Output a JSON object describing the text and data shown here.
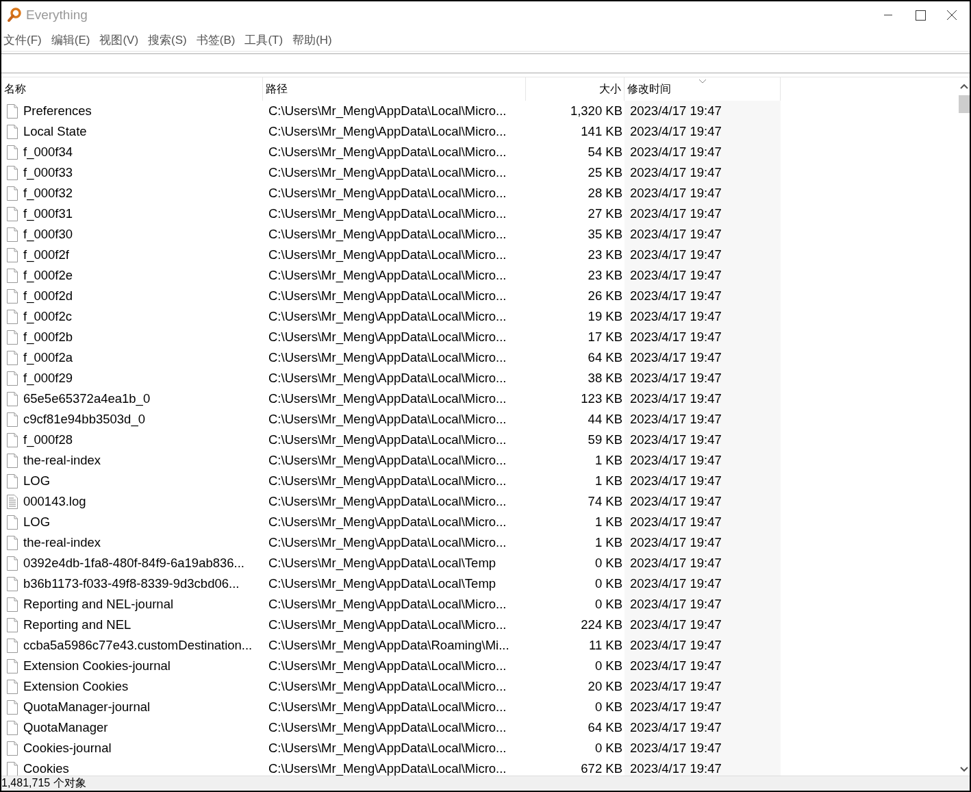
{
  "window": {
    "title": "Everything"
  },
  "menu": [
    "文件(F)",
    "编辑(E)",
    "视图(V)",
    "搜索(S)",
    "书签(B)",
    "工具(T)",
    "帮助(H)"
  ],
  "table": {
    "columns": [
      {
        "label": "名称",
        "sorted": false
      },
      {
        "label": "路径",
        "sorted": false
      },
      {
        "label": "大小",
        "sorted": false
      },
      {
        "label": "修改时间",
        "sorted": true
      }
    ],
    "rows": [
      {
        "kind": "file",
        "name": "Preferences",
        "path": "C:\\Users\\Mr_Meng\\AppData\\Local\\Micro...",
        "size": "1,320 KB",
        "modified": "2023/4/17 19:47"
      },
      {
        "kind": "file",
        "name": "Local State",
        "path": "C:\\Users\\Mr_Meng\\AppData\\Local\\Micro...",
        "size": "141 KB",
        "modified": "2023/4/17 19:47"
      },
      {
        "kind": "file",
        "name": "f_000f34",
        "path": "C:\\Users\\Mr_Meng\\AppData\\Local\\Micro...",
        "size": "54 KB",
        "modified": "2023/4/17 19:47"
      },
      {
        "kind": "file",
        "name": "f_000f33",
        "path": "C:\\Users\\Mr_Meng\\AppData\\Local\\Micro...",
        "size": "25 KB",
        "modified": "2023/4/17 19:47"
      },
      {
        "kind": "file",
        "name": "f_000f32",
        "path": "C:\\Users\\Mr_Meng\\AppData\\Local\\Micro...",
        "size": "28 KB",
        "modified": "2023/4/17 19:47"
      },
      {
        "kind": "file",
        "name": "f_000f31",
        "path": "C:\\Users\\Mr_Meng\\AppData\\Local\\Micro...",
        "size": "27 KB",
        "modified": "2023/4/17 19:47"
      },
      {
        "kind": "file",
        "name": "f_000f30",
        "path": "C:\\Users\\Mr_Meng\\AppData\\Local\\Micro...",
        "size": "35 KB",
        "modified": "2023/4/17 19:47"
      },
      {
        "kind": "file",
        "name": "f_000f2f",
        "path": "C:\\Users\\Mr_Meng\\AppData\\Local\\Micro...",
        "size": "23 KB",
        "modified": "2023/4/17 19:47"
      },
      {
        "kind": "file",
        "name": "f_000f2e",
        "path": "C:\\Users\\Mr_Meng\\AppData\\Local\\Micro...",
        "size": "23 KB",
        "modified": "2023/4/17 19:47"
      },
      {
        "kind": "file",
        "name": "f_000f2d",
        "path": "C:\\Users\\Mr_Meng\\AppData\\Local\\Micro...",
        "size": "26 KB",
        "modified": "2023/4/17 19:47"
      },
      {
        "kind": "file",
        "name": "f_000f2c",
        "path": "C:\\Users\\Mr_Meng\\AppData\\Local\\Micro...",
        "size": "19 KB",
        "modified": "2023/4/17 19:47"
      },
      {
        "kind": "file",
        "name": "f_000f2b",
        "path": "C:\\Users\\Mr_Meng\\AppData\\Local\\Micro...",
        "size": "17 KB",
        "modified": "2023/4/17 19:47"
      },
      {
        "kind": "file",
        "name": "f_000f2a",
        "path": "C:\\Users\\Mr_Meng\\AppData\\Local\\Micro...",
        "size": "64 KB",
        "modified": "2023/4/17 19:47"
      },
      {
        "kind": "file",
        "name": "f_000f29",
        "path": "C:\\Users\\Mr_Meng\\AppData\\Local\\Micro...",
        "size": "38 KB",
        "modified": "2023/4/17 19:47"
      },
      {
        "kind": "file",
        "name": "65e5e65372a4ea1b_0",
        "path": "C:\\Users\\Mr_Meng\\AppData\\Local\\Micro...",
        "size": "123 KB",
        "modified": "2023/4/17 19:47"
      },
      {
        "kind": "file",
        "name": "c9cf81e94bb3503d_0",
        "path": "C:\\Users\\Mr_Meng\\AppData\\Local\\Micro...",
        "size": "44 KB",
        "modified": "2023/4/17 19:47"
      },
      {
        "kind": "file",
        "name": "f_000f28",
        "path": "C:\\Users\\Mr_Meng\\AppData\\Local\\Micro...",
        "size": "59 KB",
        "modified": "2023/4/17 19:47"
      },
      {
        "kind": "file",
        "name": "the-real-index",
        "path": "C:\\Users\\Mr_Meng\\AppData\\Local\\Micro...",
        "size": "1 KB",
        "modified": "2023/4/17 19:47"
      },
      {
        "kind": "file",
        "name": "LOG",
        "path": "C:\\Users\\Mr_Meng\\AppData\\Local\\Micro...",
        "size": "1 KB",
        "modified": "2023/4/17 19:47"
      },
      {
        "kind": "text",
        "name": "000143.log",
        "path": "C:\\Users\\Mr_Meng\\AppData\\Local\\Micro...",
        "size": "74 KB",
        "modified": "2023/4/17 19:47"
      },
      {
        "kind": "file",
        "name": "LOG",
        "path": "C:\\Users\\Mr_Meng\\AppData\\Local\\Micro...",
        "size": "1 KB",
        "modified": "2023/4/17 19:47"
      },
      {
        "kind": "file",
        "name": "the-real-index",
        "path": "C:\\Users\\Mr_Meng\\AppData\\Local\\Micro...",
        "size": "1 KB",
        "modified": "2023/4/17 19:47"
      },
      {
        "kind": "file",
        "name": "0392e4db-1fa8-480f-84f9-6a19ab836...",
        "path": "C:\\Users\\Mr_Meng\\AppData\\Local\\Temp",
        "size": "0 KB",
        "modified": "2023/4/17 19:47"
      },
      {
        "kind": "file",
        "name": "b36b1173-f033-49f8-8339-9d3cbd06...",
        "path": "C:\\Users\\Mr_Meng\\AppData\\Local\\Temp",
        "size": "0 KB",
        "modified": "2023/4/17 19:47"
      },
      {
        "kind": "file",
        "name": "Reporting and NEL-journal",
        "path": "C:\\Users\\Mr_Meng\\AppData\\Local\\Micro...",
        "size": "0 KB",
        "modified": "2023/4/17 19:47"
      },
      {
        "kind": "file",
        "name": "Reporting and NEL",
        "path": "C:\\Users\\Mr_Meng\\AppData\\Local\\Micro...",
        "size": "224 KB",
        "modified": "2023/4/17 19:47"
      },
      {
        "kind": "file",
        "name": "ccba5a5986c77e43.customDestination...",
        "path": "C:\\Users\\Mr_Meng\\AppData\\Roaming\\Mi...",
        "size": "11 KB",
        "modified": "2023/4/17 19:47"
      },
      {
        "kind": "file",
        "name": "Extension Cookies-journal",
        "path": "C:\\Users\\Mr_Meng\\AppData\\Local\\Micro...",
        "size": "0 KB",
        "modified": "2023/4/17 19:47"
      },
      {
        "kind": "file",
        "name": "Extension Cookies",
        "path": "C:\\Users\\Mr_Meng\\AppData\\Local\\Micro...",
        "size": "20 KB",
        "modified": "2023/4/17 19:47"
      },
      {
        "kind": "file",
        "name": "QuotaManager-journal",
        "path": "C:\\Users\\Mr_Meng\\AppData\\Local\\Micro...",
        "size": "0 KB",
        "modified": "2023/4/17 19:47"
      },
      {
        "kind": "file",
        "name": "QuotaManager",
        "path": "C:\\Users\\Mr_Meng\\AppData\\Local\\Micro...",
        "size": "64 KB",
        "modified": "2023/4/17 19:47"
      },
      {
        "kind": "file",
        "name": "Cookies-journal",
        "path": "C:\\Users\\Mr_Meng\\AppData\\Local\\Micro...",
        "size": "0 KB",
        "modified": "2023/4/17 19:47"
      },
      {
        "kind": "file",
        "name": "Cookies",
        "path": "C:\\Users\\Mr_Meng\\AppData\\Local\\Micro...",
        "size": "672 KB",
        "modified": "2023/4/17 19:47"
      }
    ]
  },
  "status_bar": "1,481,715 个对象"
}
